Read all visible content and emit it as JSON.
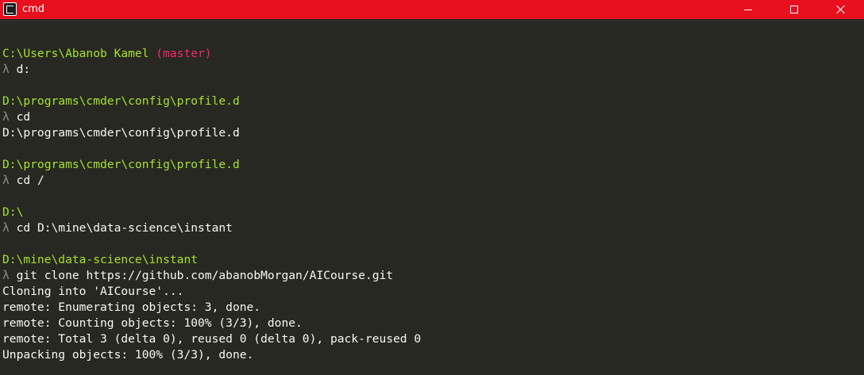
{
  "window": {
    "title": "cmd"
  },
  "terminal": {
    "lines": [
      {
        "type": "path",
        "text": "C:\\Users\\Abanob Kamel",
        "branch": " (master)"
      },
      {
        "type": "cmd",
        "prompt": "λ",
        "text": "d:"
      },
      {
        "type": "blank"
      },
      {
        "type": "path",
        "text": "D:\\programs\\cmder\\config\\profile.d"
      },
      {
        "type": "cmd",
        "prompt": "λ",
        "text": "cd"
      },
      {
        "type": "out",
        "text": "D:\\programs\\cmder\\config\\profile.d"
      },
      {
        "type": "blank"
      },
      {
        "type": "path",
        "text": "D:\\programs\\cmder\\config\\profile.d"
      },
      {
        "type": "cmd",
        "prompt": "λ",
        "text": "cd /"
      },
      {
        "type": "blank"
      },
      {
        "type": "path",
        "text": "D:\\"
      },
      {
        "type": "cmd",
        "prompt": "λ",
        "text": "cd D:\\mine\\data-science\\instant"
      },
      {
        "type": "blank"
      },
      {
        "type": "path",
        "text": "D:\\mine\\data-science\\instant"
      },
      {
        "type": "cmd",
        "prompt": "λ",
        "text": "git clone https://github.com/abanobMorgan/AICourse.git"
      },
      {
        "type": "out",
        "text": "Cloning into 'AICourse'..."
      },
      {
        "type": "out",
        "text": "remote: Enumerating objects: 3, done."
      },
      {
        "type": "out",
        "text": "remote: Counting objects: 100% (3/3), done."
      },
      {
        "type": "out",
        "text": "remote: Total 3 (delta 0), reused 0 (delta 0), pack-reused 0"
      },
      {
        "type": "out",
        "text": "Unpacking objects: 100% (3/3), done."
      }
    ]
  },
  "colors": {
    "titlebar": "#e8101f",
    "background": "#272822",
    "path": "#a6e22e",
    "branch": "#f92672",
    "prompt": "#8c8c8c",
    "text": "#f8f8f2"
  }
}
